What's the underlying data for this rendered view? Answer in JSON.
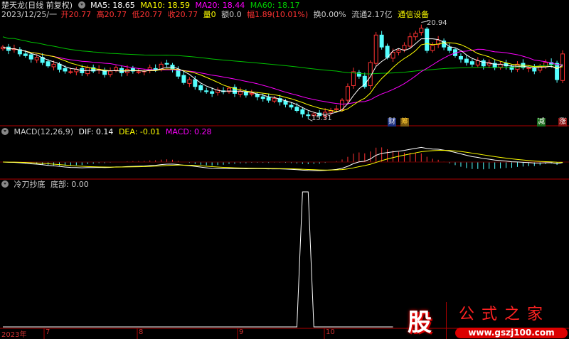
{
  "header": {
    "title": "楚天龙(日线 前复权)",
    "ma5": "MA5: 18.65",
    "ma10": "MA10: 18.59",
    "ma20": "MA20: 18.44",
    "ma60": "MA60: 18.17",
    "date": "2023/12/25/一",
    "open": "开20.77",
    "high": "高20.77",
    "low": "低20.77",
    "close": "收20.77",
    "volume": "量0",
    "amount": "额0.0",
    "change": "幅1.89(10.01%)",
    "turnover": "换0.00%",
    "float": "流通2.17亿",
    "sector": "通信设备"
  },
  "macd_header": {
    "label": "MACD(12,26,9)",
    "dif": "DIF: 0.14",
    "dea": "DEA: -0.01",
    "macd": "MACD: 0.28"
  },
  "indicator_header": {
    "label": "冷刀抄底",
    "value": "底部: 0.00"
  },
  "annotations": {
    "high": "20.94",
    "low": "15.31"
  },
  "badges": [
    "财",
    "筹",
    "减",
    "涨"
  ],
  "x_axis": [
    "2023年",
    "7",
    "8",
    "9",
    "10"
  ],
  "logo": {
    "char": "股",
    "name": "公式之家",
    "url": "www.gszj100.com"
  },
  "colors": {
    "up": "#ff3232",
    "down": "#54ffff",
    "ma5": "#ffffff",
    "ma10": "#ffff00",
    "ma20": "#ff00ff",
    "ma60": "#00c000",
    "divider": "#b00000"
  },
  "chart_data": {
    "type": "candlestick",
    "price_range": [
      15.31,
      20.94
    ],
    "closes": [
      19.5,
      19.3,
      19.4,
      19.1,
      19.0,
      18.8,
      18.9,
      18.6,
      18.4,
      18.5,
      18.2,
      18.1,
      18.06,
      18.2,
      18.0,
      18.3,
      18.1,
      18.2,
      17.9,
      18.1,
      18.3,
      18.0,
      18.2,
      18.1,
      18.06,
      18.1,
      18.3,
      18.2,
      18.5,
      18.5,
      18.2,
      17.8,
      17.43,
      17.6,
      17.2,
      17.0,
      16.9,
      16.8,
      17.0,
      16.9,
      17.1,
      16.8,
      16.9,
      16.7,
      16.8,
      16.6,
      16.5,
      16.4,
      16.5,
      16.3,
      16.16,
      16.0,
      15.8,
      15.6,
      15.5,
      15.6,
      15.5,
      15.7,
      15.8,
      15.9,
      16.4,
      17.2,
      18.06,
      17.8,
      17.2,
      18.6,
      20.2,
      19.5,
      18.9,
      19.2,
      19.3,
      19.6,
      20.1,
      20.3,
      20.6,
      19.3,
      19.6,
      19.9,
      19.5,
      19.3,
      19.0,
      18.8,
      18.6,
      18.5,
      18.7,
      18.4,
      18.6,
      18.3,
      18.5,
      18.4,
      18.2,
      18.5,
      18.3,
      18.3,
      18.1,
      18.4,
      18.6,
      18.5,
      17.6,
      19.1
    ],
    "signal": [
      0,
      0,
      0,
      0,
      0,
      0,
      0,
      0,
      0,
      0,
      0,
      0,
      0,
      0,
      0,
      0,
      0,
      0,
      0,
      0,
      0,
      0,
      0,
      0,
      0,
      0,
      0,
      0,
      0,
      0,
      0,
      0,
      0,
      0,
      0,
      0,
      0,
      0,
      0,
      0,
      0,
      0,
      0,
      0,
      0,
      0,
      0,
      0,
      0,
      0,
      0,
      0,
      0,
      1,
      1,
      0,
      0,
      0,
      0,
      0,
      0,
      0,
      0,
      0,
      0,
      0,
      0,
      0,
      0,
      0
    ]
  }
}
